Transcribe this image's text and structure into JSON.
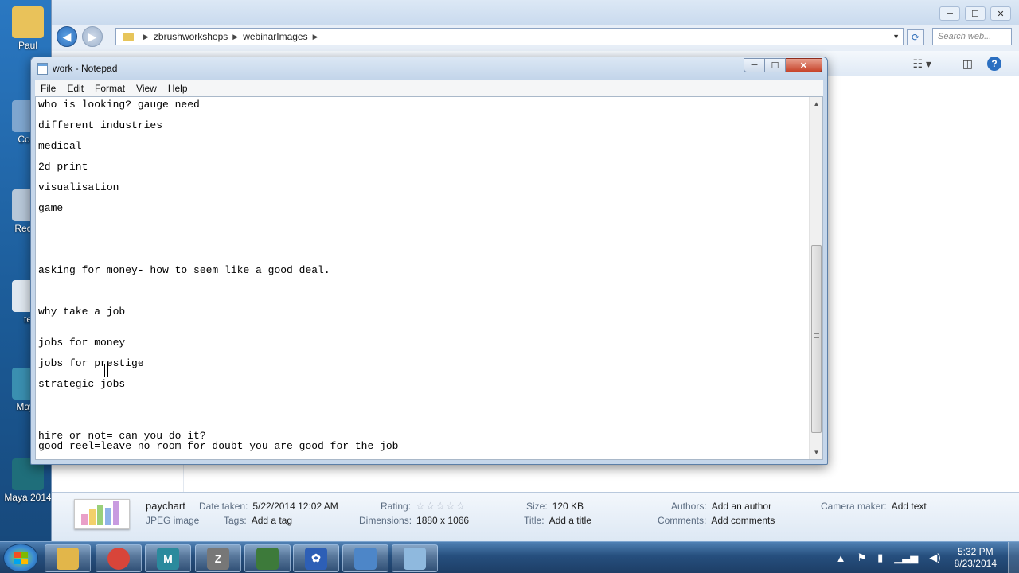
{
  "desktop": {
    "icons": [
      {
        "label": "Paul",
        "color": "#e9c25a"
      },
      {
        "label": "Com",
        "color": "#7fa6cf"
      },
      {
        "label": "Recyc",
        "color": "#b7c7d8"
      },
      {
        "label": "te",
        "color": "#dfe7ef"
      },
      {
        "label": "Maya",
        "color": "#3a8fb0"
      },
      {
        "label": "Maya 2014",
        "color": "#1f6e7a"
      }
    ]
  },
  "explorer": {
    "window_controls": [
      "─",
      "☐",
      "✕"
    ],
    "address": {
      "crumbs": [
        "zbrushworkshops",
        "webinarImages"
      ]
    },
    "search_placeholder": "Search web...",
    "help_label": "?",
    "details": {
      "file_name": "paychart",
      "file_type": "JPEG image",
      "date_taken_label": "Date taken:",
      "date_taken": "5/22/2014 12:02 AM",
      "tags_label": "Tags:",
      "tags": "Add a tag",
      "rating_label": "Rating:",
      "rating_stars": "☆☆☆☆☆",
      "dimensions_label": "Dimensions:",
      "dimensions": "1880 x 1066",
      "size_label": "Size:",
      "size": "120 KB",
      "title_label": "Title:",
      "title": "Add a title",
      "authors_label": "Authors:",
      "authors": "Add an author",
      "comments_label": "Comments:",
      "comments": "Add comments",
      "camera_label": "Camera maker:",
      "camera": "Add text"
    }
  },
  "notepad": {
    "title": "work - Notepad",
    "controls": {
      "min": "─",
      "max": "☐",
      "close": "✕"
    },
    "menu": [
      "File",
      "Edit",
      "Format",
      "View",
      "Help"
    ],
    "lines": [
      "who is looking? gauge need",
      "different industries",
      "medical",
      "2d print",
      "visualisation",
      "game",
      "asking for money- how to seem like a good deal.",
      "why take a job",
      "jobs for money",
      "jobs for prestige",
      "strategic jobs",
      "hire or not= can you do it?",
      "good reel=leave no room for doubt you are good for the job"
    ],
    "scroll_up": "▲",
    "scroll_down": "▼"
  },
  "taskbar": {
    "apps": [
      {
        "name": "explorer",
        "color": "#e2b64a",
        "glyph": ""
      },
      {
        "name": "chrome",
        "color": "#d8453a",
        "glyph": ""
      },
      {
        "name": "maya",
        "color": "#2b8a9d",
        "glyph": "M"
      },
      {
        "name": "zbrush",
        "color": "#777777",
        "glyph": "Z"
      },
      {
        "name": "terminal",
        "color": "#3d7a3a",
        "glyph": ""
      },
      {
        "name": "app-flower",
        "color": "#2d5fb6",
        "glyph": "✿"
      },
      {
        "name": "control-panel",
        "color": "#4d86c8",
        "glyph": ""
      },
      {
        "name": "notepad",
        "color": "#8fb9de",
        "glyph": ""
      }
    ],
    "clock_time": "5:32 PM",
    "clock_date": "8/23/2014"
  }
}
